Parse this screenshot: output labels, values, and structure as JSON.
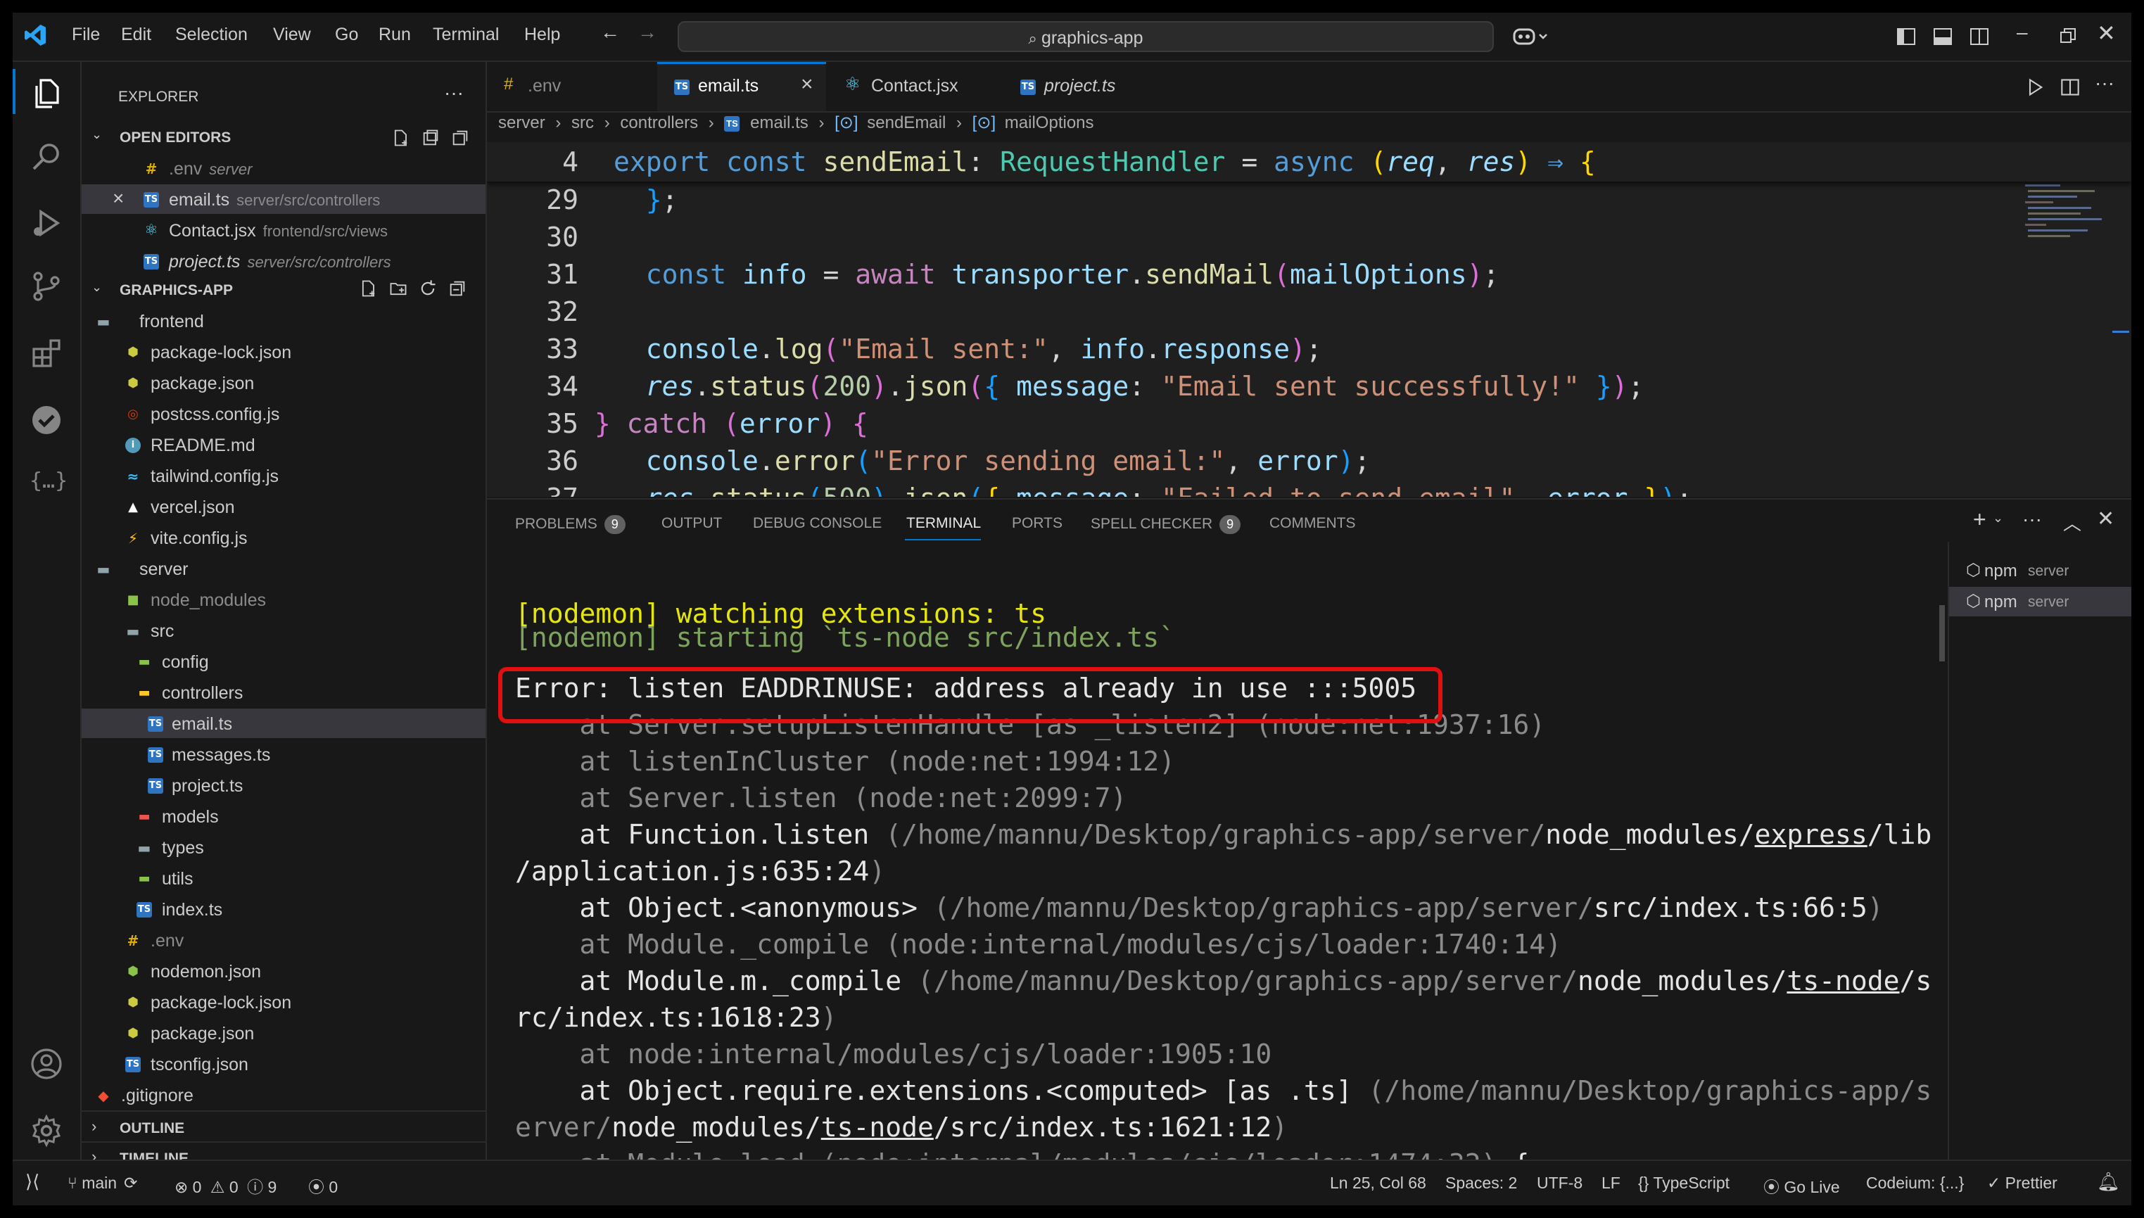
{
  "titlebar": {
    "menu": [
      "File",
      "Edit",
      "Selection",
      "View",
      "Go",
      "Run",
      "Terminal",
      "Help"
    ],
    "command_center": "graphics-app"
  },
  "sidebar": {
    "title": "EXPLORER",
    "open_editors_label": "OPEN EDITORS",
    "open_editors": [
      {
        "name": ".env",
        "hint": "server"
      },
      {
        "name": "email.ts",
        "hint": "server/src/controllers"
      },
      {
        "name": "Contact.jsx",
        "hint": "frontend/src/views"
      },
      {
        "name": "project.ts",
        "hint": "server/src/controllers"
      }
    ],
    "project_label": "GRAPHICS-APP",
    "tree": [
      "frontend",
      "package-lock.json",
      "package.json",
      "postcss.config.js",
      "README.md",
      "tailwind.config.js",
      "vercel.json",
      "vite.config.js",
      "server",
      "node_modules",
      "src",
      "config",
      "controllers",
      "email.ts",
      "messages.ts",
      "project.ts",
      "models",
      "types",
      "utils",
      "index.ts",
      ".env",
      "nodemon.json",
      "package-lock.json",
      "package.json",
      "tsconfig.json",
      ".gitignore"
    ],
    "outline_label": "OUTLINE",
    "timeline_label": "TIMELINE"
  },
  "tabs": [
    ".env",
    "email.ts",
    "Contact.jsx",
    "project.ts"
  ],
  "breadcrumb": [
    "server",
    "src",
    "controllers",
    "email.ts",
    "sendEmail",
    "mailOptions"
  ],
  "editor": {
    "line_numbers": [
      "4",
      "29",
      "30",
      "31",
      "32",
      "33",
      "34",
      "35",
      "36",
      "37"
    ]
  },
  "panel": {
    "tabs": [
      "PROBLEMS",
      "OUTPUT",
      "DEBUG CONSOLE",
      "TERMINAL",
      "PORTS",
      "SPELL CHECKER",
      "COMMENTS"
    ],
    "problems_count": "9",
    "spell_count": "9",
    "terminals": [
      {
        "name": "npm",
        "hint": "server"
      },
      {
        "name": "npm",
        "hint": "server"
      }
    ],
    "error_line": "Error: listen EADDRINUSE: address already in use :::5005"
  },
  "statusbar": {
    "branch": "main",
    "errors": "0",
    "warnings": "0",
    "infos": "9",
    "ports": "0",
    "position": "Ln 25, Col 68",
    "spaces": "Spaces: 2",
    "encoding": "UTF-8",
    "eol": "LF",
    "language": "TypeScript",
    "golive": "Go Live",
    "codeium": "Codeium: {...}",
    "prettier": "Prettier"
  },
  "colors": {
    "accent": "#0078d4",
    "error_box": "#e01010",
    "background": "#181818",
    "editor_bg": "#1f1f1f"
  }
}
